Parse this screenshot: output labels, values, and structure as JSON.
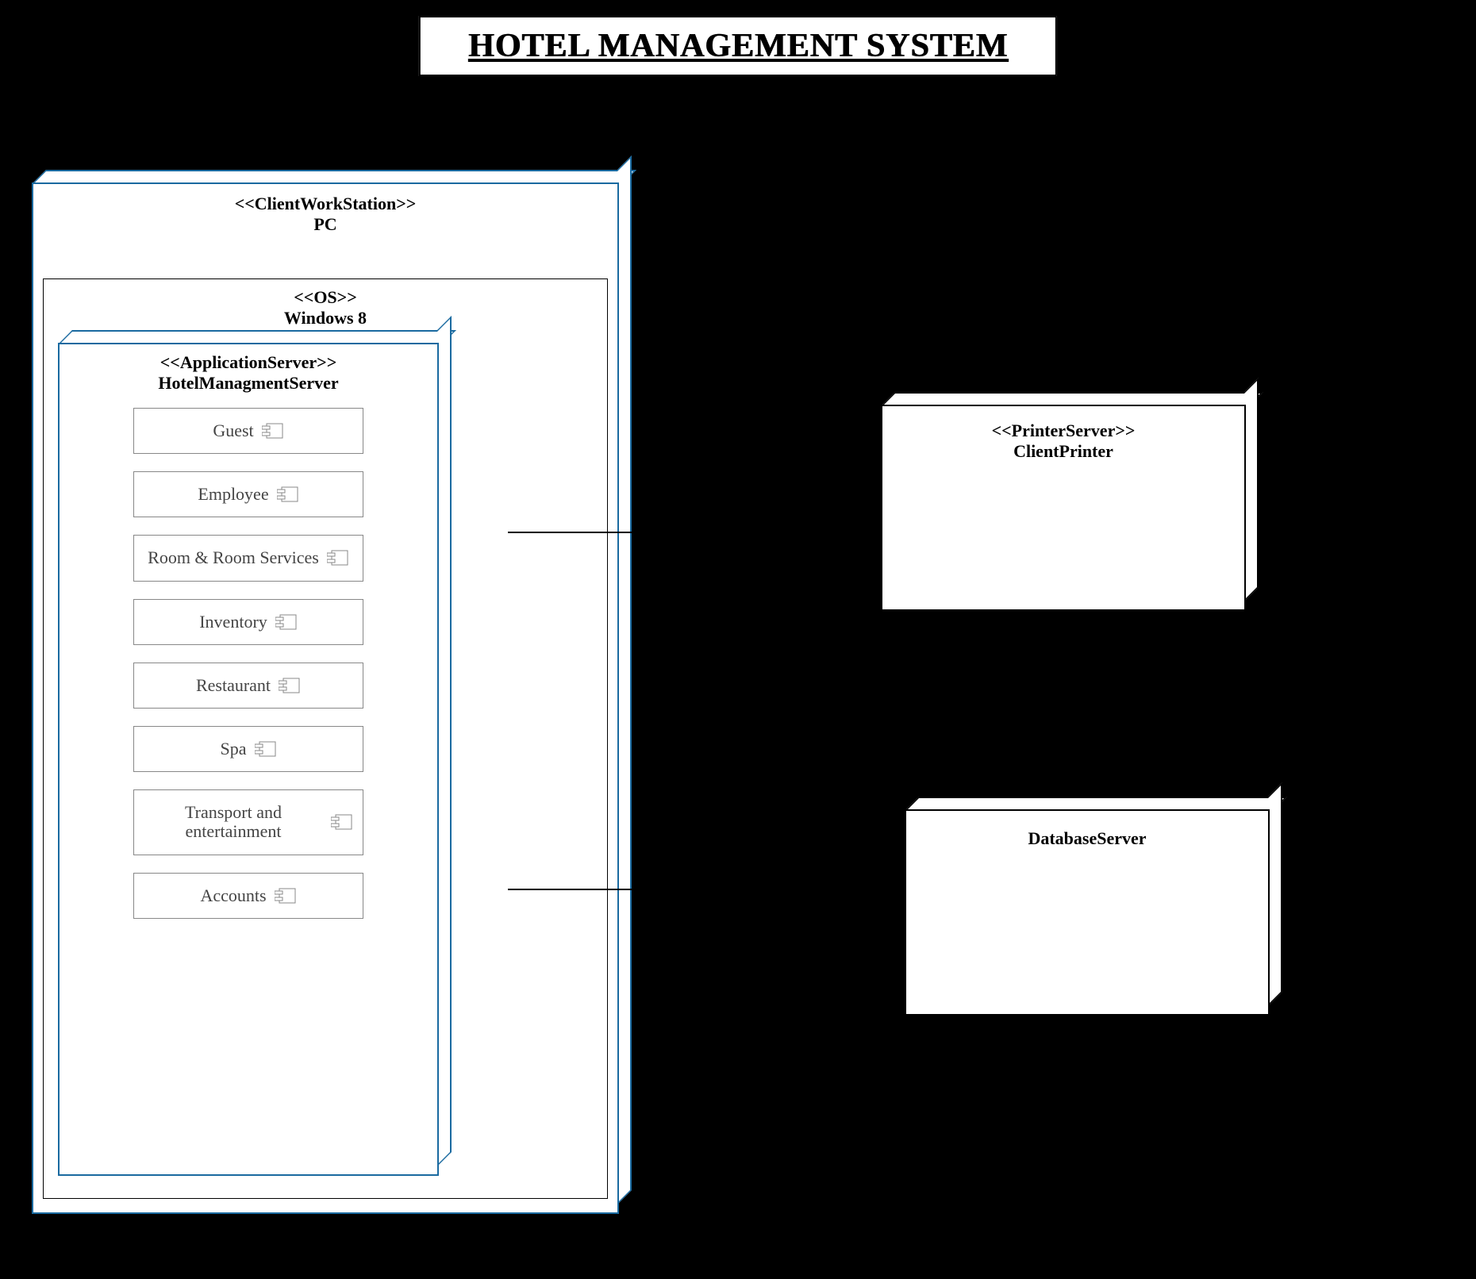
{
  "title": "HOTEL MANAGEMENT SYSTEM",
  "pc": {
    "stereotype": "<<ClientWorkStation>>",
    "name": "PC"
  },
  "os": {
    "stereotype": "<<OS>>",
    "name": "Windows 8"
  },
  "appserver": {
    "stereotype": "<<ApplicationServer>>",
    "name": "HotelManagmentServer"
  },
  "components": [
    "Guest",
    "Employee",
    "Room & Room Services",
    "Inventory",
    "Restaurant",
    "Spa",
    "Transport and entertainment",
    "Accounts"
  ],
  "printer": {
    "stereotype": "<<PrinterServer>>",
    "name": "ClientPrinter"
  },
  "db": {
    "name": "DatabaseServer"
  }
}
